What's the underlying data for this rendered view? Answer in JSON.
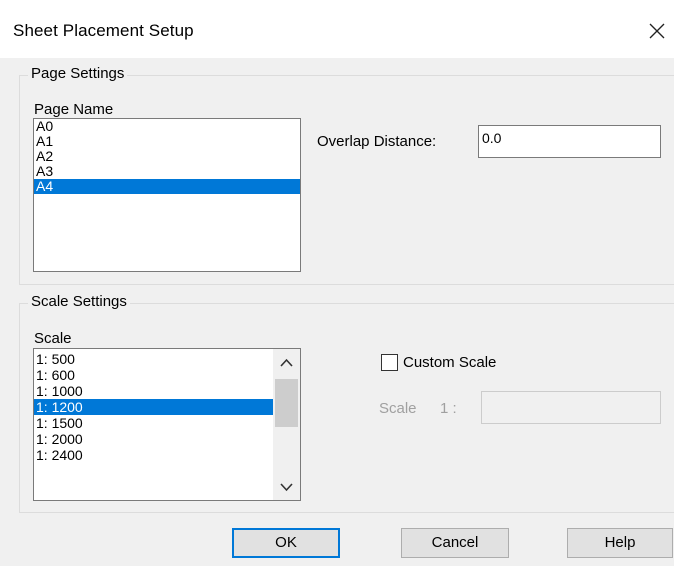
{
  "dialog": {
    "title": "Sheet Placement Setup",
    "close_icon": "close-icon"
  },
  "page_settings": {
    "group_title": "Page Settings",
    "list_label": "Page Name",
    "items": [
      "A0",
      "A1",
      "A2",
      "A3",
      "A4"
    ],
    "selected": "A4",
    "overlap_label": "Overlap Distance:",
    "overlap_value": "0.0"
  },
  "scale_settings": {
    "group_title": "Scale Settings",
    "list_label": "Scale",
    "items": [
      "1:  500",
      "1:  600",
      "1: 1000",
      "1: 1200",
      "1: 1500",
      "1: 2000",
      "1: 2400"
    ],
    "selected": "1: 1200",
    "custom_scale_label": "Custom Scale",
    "custom_scale_checked": false,
    "scale_prefix": "Scale",
    "scale_ratio": "1 :",
    "scale_value": ""
  },
  "buttons": {
    "ok": "OK",
    "cancel": "Cancel",
    "help": "Help"
  },
  "colors": {
    "selection": "#0078d7",
    "dialog_bg": "#f0f0f0",
    "disabled_text": "#a0a0a0"
  }
}
